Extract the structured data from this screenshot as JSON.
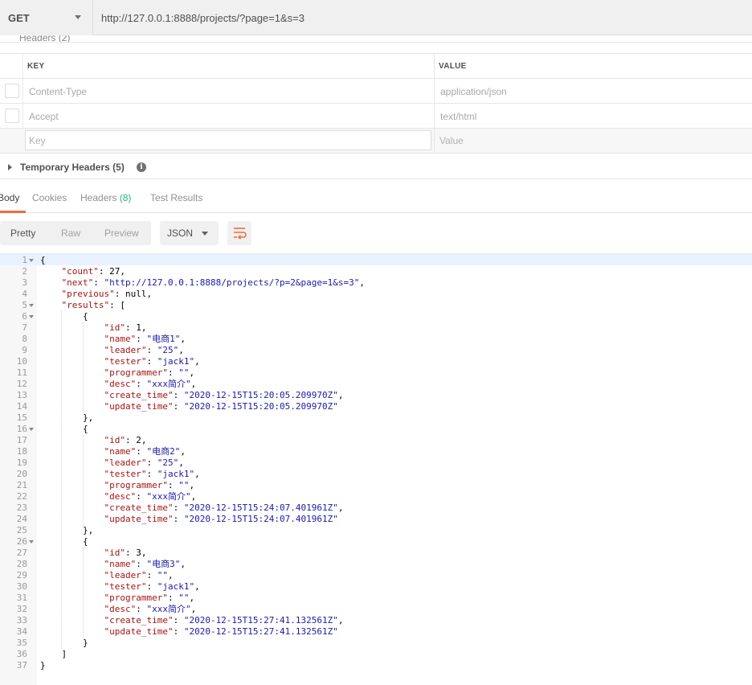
{
  "request": {
    "method": "GET",
    "url": "http://127.0.0.1:8888/projects/?page=1&s=3",
    "section_heading_clipped": "Headers (2)"
  },
  "headers_table": {
    "key_header": "KEY",
    "value_header": "VALUE",
    "rows": [
      {
        "key": "Content-Type",
        "value": "application/json"
      },
      {
        "key": "Accept",
        "value": "text/html"
      }
    ],
    "new_key_placeholder": "Key",
    "new_value_placeholder": "Value"
  },
  "temporary_headers": {
    "label": "Temporary Headers",
    "count": "(5)",
    "info_glyph": "i"
  },
  "response_tabs": {
    "body": "Body",
    "cookies": "Cookies",
    "headers": "Headers",
    "headers_count": "(8)",
    "test_results": "Test Results"
  },
  "body_toolbar": {
    "pretty": "Pretty",
    "raw": "Raw",
    "preview": "Preview",
    "format": "JSON",
    "wrap_icon": "wrap-lines-icon"
  },
  "colors": {
    "accent": "#f26b3a",
    "badge": "#26b47f",
    "json_key": "#a31515",
    "json_string": "#1a1aa6"
  },
  "code_lines": [
    "{",
    "    \"count\": 27,",
    "    \"next\": \"http://127.0.0.1:8888/projects/?p=2&page=1&s=3\",",
    "    \"previous\": null,",
    "    \"results\": [",
    "        {",
    "            \"id\": 1,",
    "            \"name\": \"电商1\",",
    "            \"leader\": \"25\",",
    "            \"tester\": \"jack1\",",
    "            \"programmer\": \"\",",
    "            \"desc\": \"xxx简介\",",
    "            \"create_time\": \"2020-12-15T15:20:05.209970Z\",",
    "            \"update_time\": \"2020-12-15T15:20:05.209970Z\"",
    "        },",
    "        {",
    "            \"id\": 2,",
    "            \"name\": \"电商2\",",
    "            \"leader\": \"25\",",
    "            \"tester\": \"jack1\",",
    "            \"programmer\": \"\",",
    "            \"desc\": \"xxx简介\",",
    "            \"create_time\": \"2020-12-15T15:24:07.401961Z\",",
    "            \"update_time\": \"2020-12-15T15:24:07.401961Z\"",
    "        },",
    "        {",
    "            \"id\": 3,",
    "            \"name\": \"电商3\",",
    "            \"leader\": \"\",",
    "            \"tester\": \"jack1\",",
    "            \"programmer\": \"\",",
    "            \"desc\": \"xxx简介\",",
    "            \"create_time\": \"2020-12-15T15:27:41.132561Z\",",
    "            \"update_time\": \"2020-12-15T15:27:41.132561Z\"",
    "        }",
    "    ]",
    "}"
  ]
}
